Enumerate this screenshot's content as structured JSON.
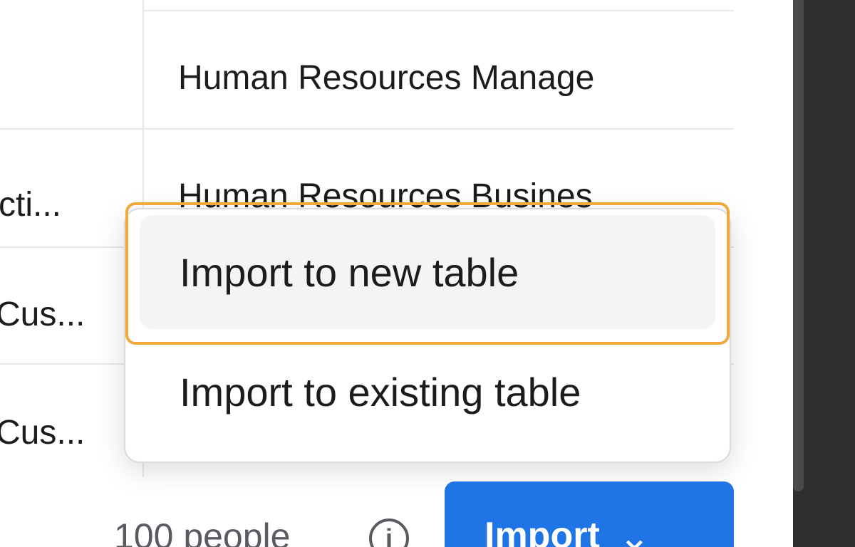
{
  "table": {
    "rows": [
      {
        "left": "",
        "right": "Human Resources Manage"
      },
      {
        "left": "cti...",
        "right": "Human Resources Busines"
      },
      {
        "left": "Cus...",
        "right": ""
      },
      {
        "left": "Cus...",
        "right": ""
      }
    ]
  },
  "dropdown": {
    "items": [
      {
        "label": "Import to new table"
      },
      {
        "label": "Import to existing table"
      }
    ]
  },
  "footer": {
    "count": "100 people",
    "info_icon": "info-icon",
    "import_label": "Import",
    "chevron": "⌄"
  },
  "colors": {
    "accent": "#1f74e6",
    "highlight": "#f2a93b"
  }
}
